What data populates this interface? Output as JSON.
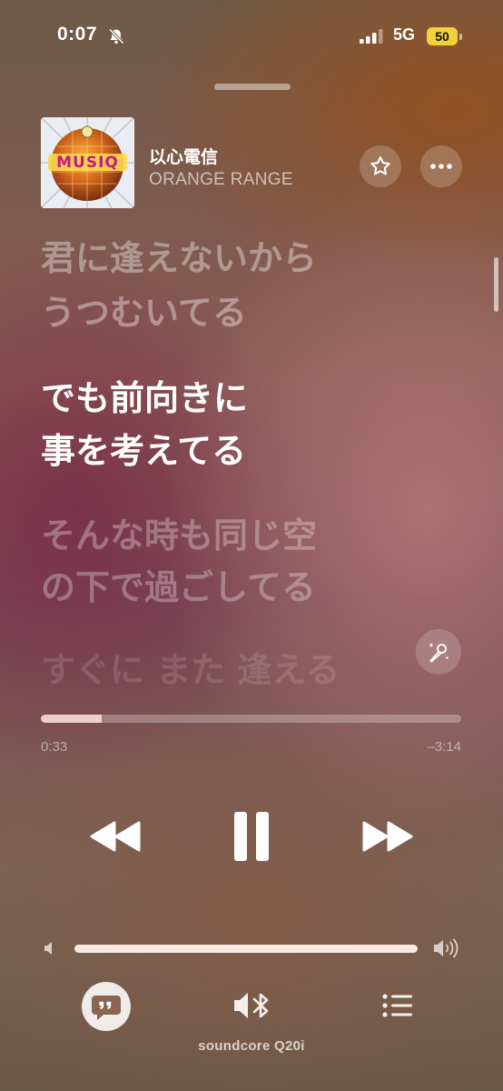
{
  "status_bar": {
    "time": "0:07",
    "network": "5G",
    "battery": "50"
  },
  "now_playing": {
    "title": "以心電信",
    "artist": "ORANGE RANGE",
    "album_art_text": "MUSIQ"
  },
  "lyrics": {
    "lines": [
      "君に逢えないから",
      "うつむいてる",
      "でも前向きに",
      "事を考えてる",
      "そんな時も同じ空",
      "の下で過ごしてる",
      "すぐに また 逢える"
    ],
    "active_lines": [
      2,
      3
    ]
  },
  "playback": {
    "elapsed": "0:33",
    "remaining": "–3:14",
    "progress_fraction": 0.145
  },
  "volume": {
    "level_fraction": 1.0
  },
  "output": {
    "device_name": "soundcore Q20i"
  },
  "icons": {
    "bell": "bell-slash-icon",
    "star": "star-icon",
    "more": "ellipsis-icon",
    "sing": "microphone-sparkle-icon",
    "rewind": "backward-icon",
    "pause": "pause-icon",
    "forward": "forward-icon",
    "lyrics": "quote-bubble-icon",
    "airplay": "speaker-bluetooth-icon",
    "queue": "list-icon"
  },
  "colors": {
    "battery": "#f2d13c"
  }
}
